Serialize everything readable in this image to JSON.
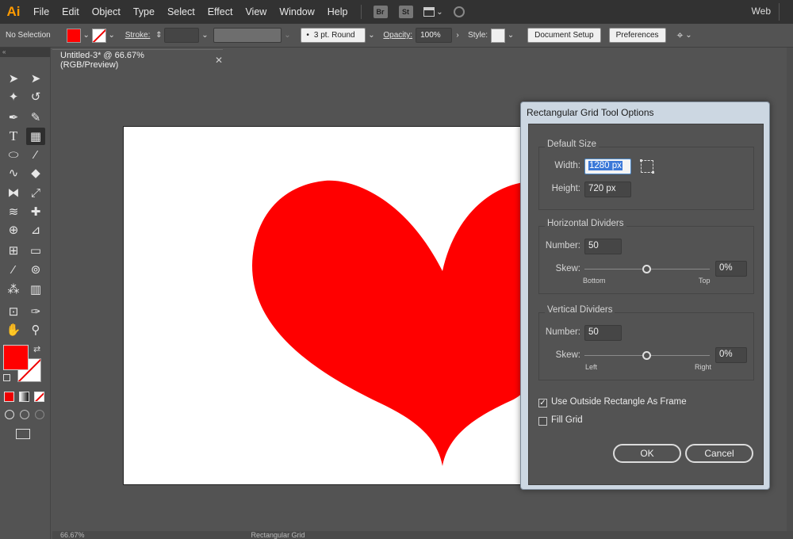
{
  "app": {
    "logo": "Ai",
    "menus": [
      "File",
      "Edit",
      "Object",
      "Type",
      "Select",
      "Effect",
      "View",
      "Window",
      "Help"
    ],
    "bridge": "Br",
    "stock": "St",
    "workspace": "Web"
  },
  "control_bar": {
    "selection": "No Selection",
    "stroke_label": "Stroke:",
    "brush": "3 pt. Round",
    "opacity_label": "Opacity:",
    "opacity_value": "100%",
    "style_label": "Style:",
    "doc_setup": "Document Setup",
    "preferences": "Preferences",
    "fill_color": "#ff0000"
  },
  "document": {
    "tab_title": "Untitled-3* @ 66.67% (RGB/Preview)",
    "status_zoom": "66.67%",
    "status_tool": "Rectangular Grid",
    "heart_color": "#ff0000"
  },
  "dialog": {
    "title": "Rectangular Grid Tool Options",
    "default_size": {
      "legend": "Default Size",
      "width_label": "Width:",
      "width_value": "1280 px",
      "height_label": "Height:",
      "height_value": "720 px"
    },
    "horizontal": {
      "legend": "Horizontal Dividers",
      "number_label": "Number:",
      "number_value": "50",
      "skew_label": "Skew:",
      "skew_value": "0%",
      "min_label": "Bottom",
      "max_label": "Top",
      "skew_fraction": 0.5
    },
    "vertical": {
      "legend": "Vertical Dividers",
      "number_label": "Number:",
      "number_value": "50",
      "skew_label": "Skew:",
      "skew_value": "0%",
      "min_label": "Left",
      "max_label": "Right",
      "skew_fraction": 0.5
    },
    "use_outside_rect": "Use Outside Rectangle As Frame",
    "use_outside_rect_checked": true,
    "fill_grid": "Fill Grid",
    "fill_grid_checked": false,
    "ok": "OK",
    "cancel": "Cancel"
  }
}
